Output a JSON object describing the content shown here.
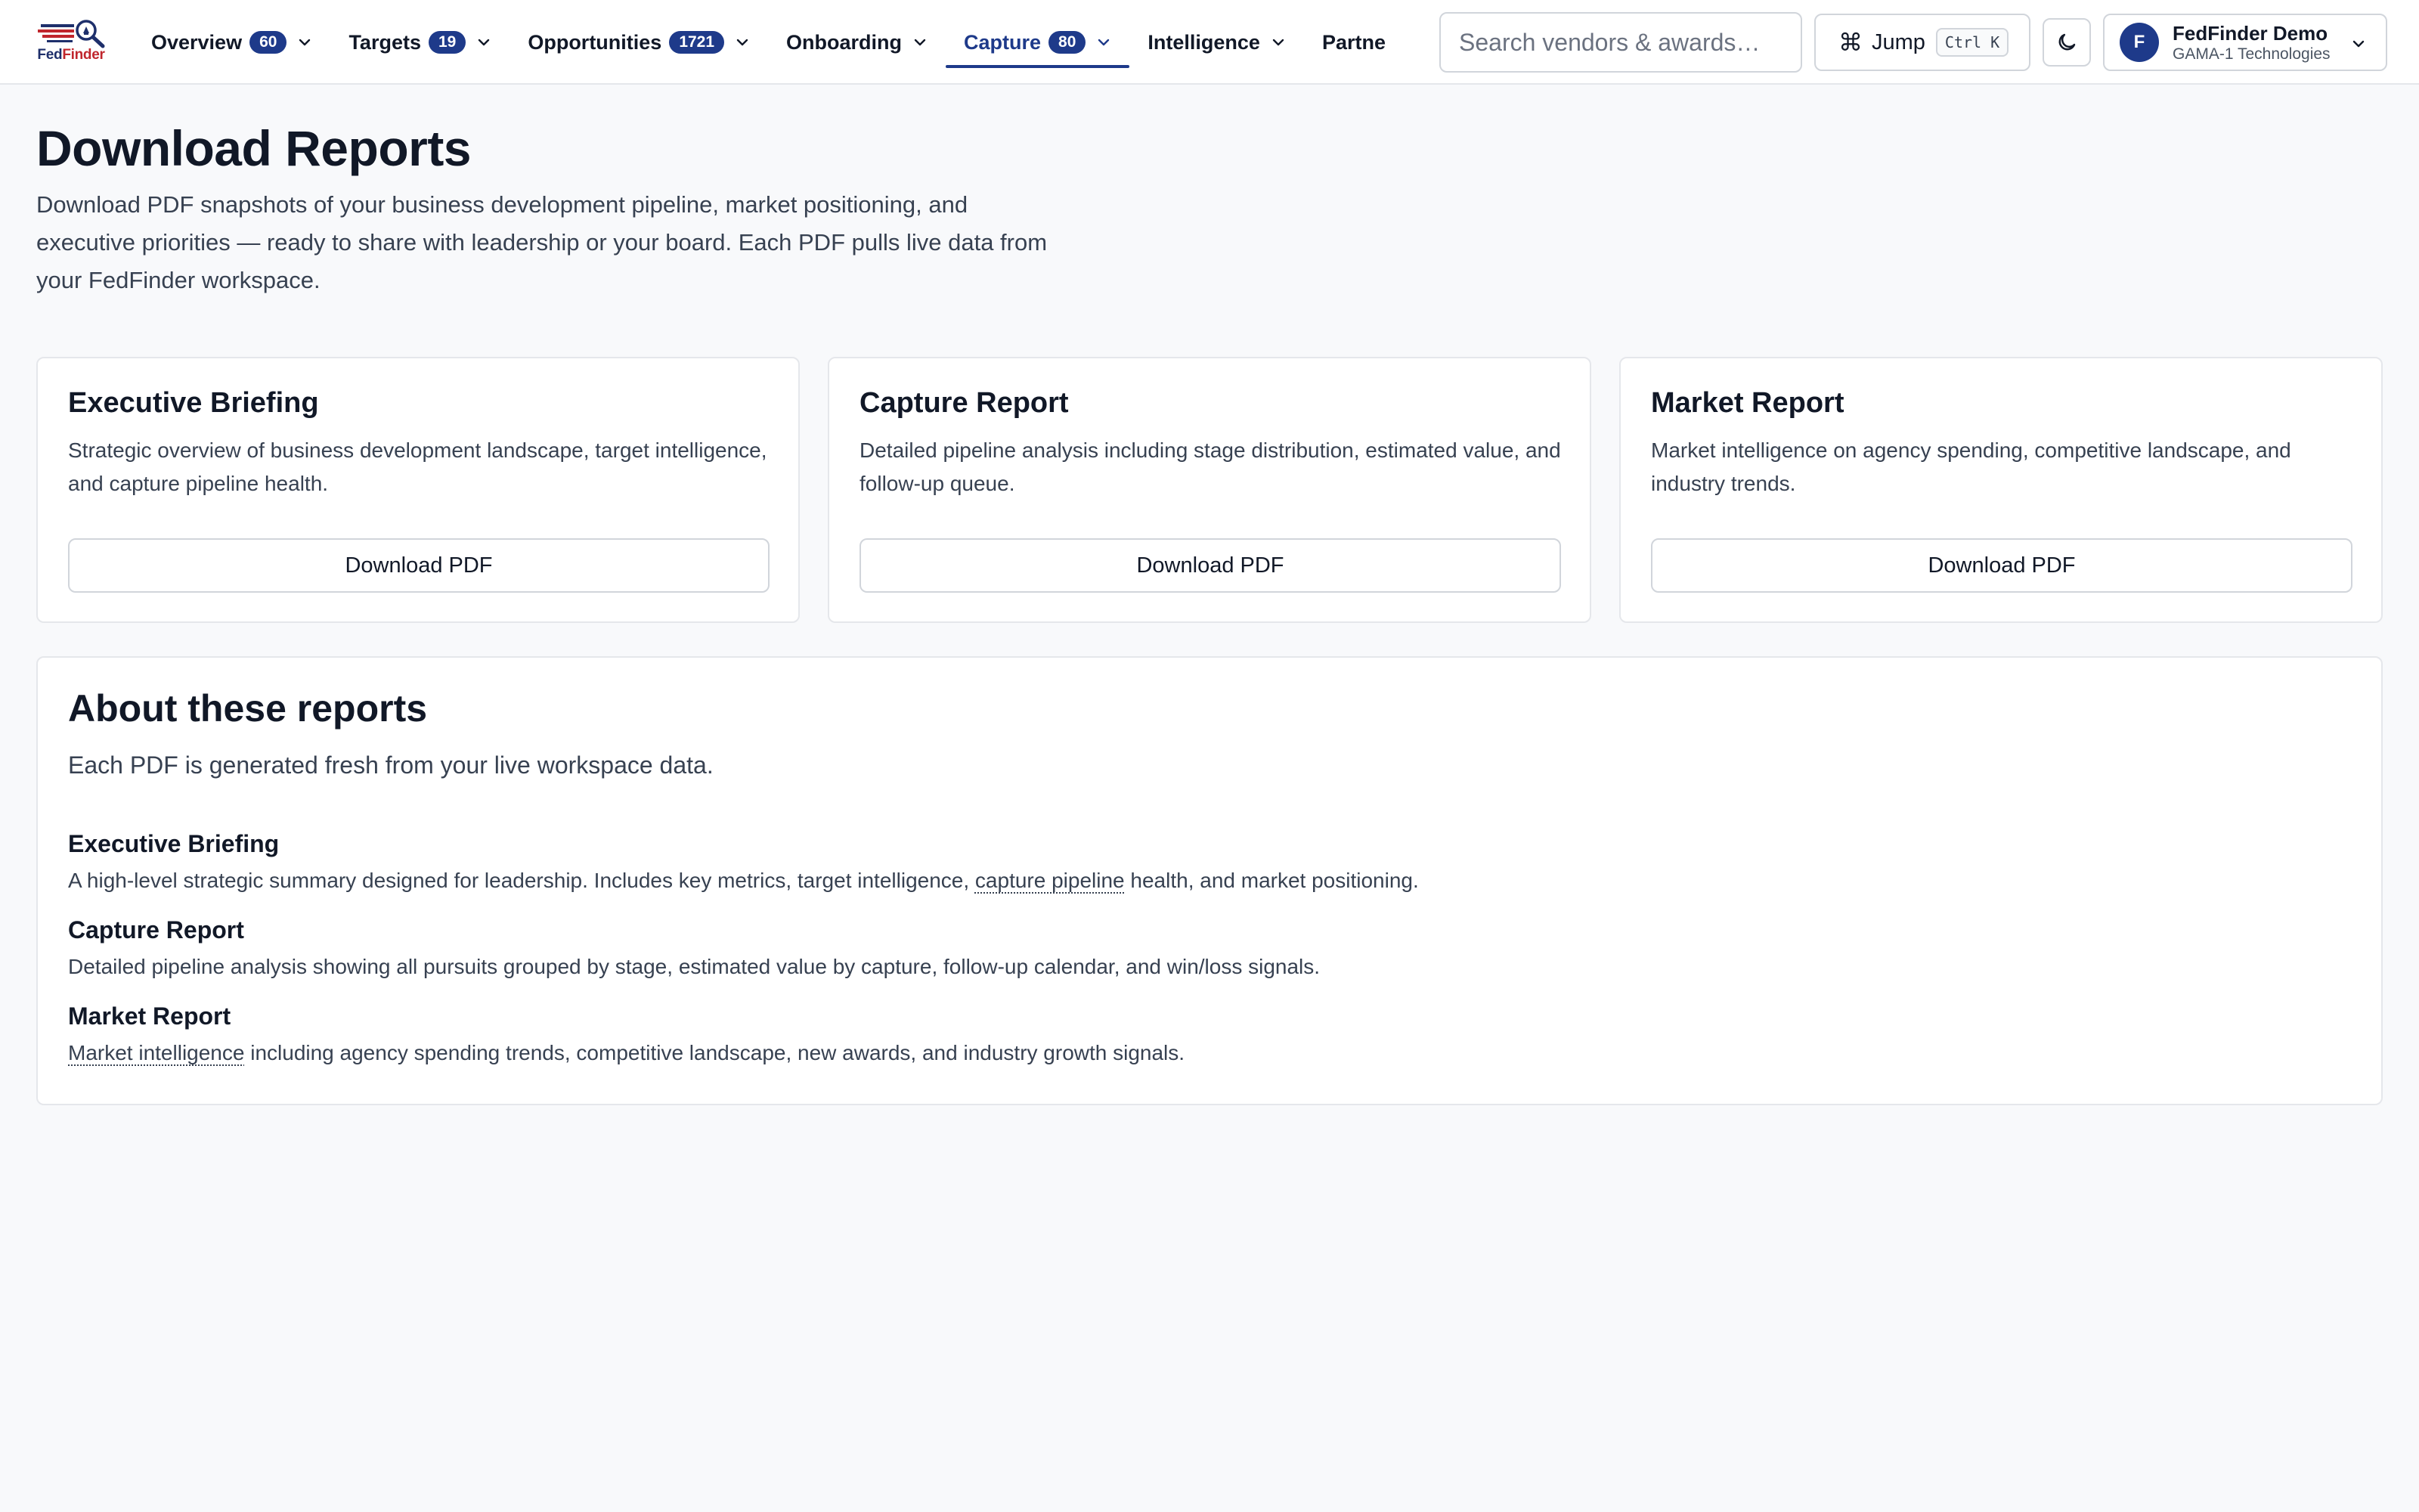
{
  "header": {
    "logo_fed": "Fed",
    "logo_finder": "Finder",
    "nav": [
      {
        "label": "Overview",
        "badge": "60"
      },
      {
        "label": "Targets",
        "badge": "19"
      },
      {
        "label": "Opportunities",
        "badge": "1721"
      },
      {
        "label": "Onboarding",
        "badge": ""
      },
      {
        "label": "Capture",
        "badge": "80",
        "active": true
      },
      {
        "label": "Intelligence",
        "badge": ""
      },
      {
        "label": "Partne",
        "badge": ""
      }
    ],
    "search_placeholder": "Search vendors & awards…",
    "jump_label": "Jump",
    "jump_shortcut": "Ctrl K",
    "jump_icon": "⌘",
    "theme_icon": "moon-icon",
    "user": {
      "initial": "F",
      "name": "FedFinder Demo",
      "org": "GAMA-1 Technologies"
    },
    "accent_color": "#1e3a8a"
  },
  "page": {
    "title": "Download Reports",
    "description": "Download PDF snapshots of your business development pipeline, market positioning, and executive priorities — ready to share with leadership or your board. Each PDF pulls live data from your FedFinder workspace."
  },
  "cards": [
    {
      "title": "Executive Briefing",
      "description": "Strategic overview of business development landscape, target intelligence, and capture pipeline health.",
      "button": "Download PDF"
    },
    {
      "title": "Capture Report",
      "description": "Detailed pipeline analysis including stage distribution, estimated value, and follow-up queue.",
      "button": "Download PDF"
    },
    {
      "title": "Market Report",
      "description": "Market intelligence on agency spending, competitive landscape, and industry trends.",
      "button": "Download PDF"
    }
  ],
  "about": {
    "title": "About these reports",
    "subtitle": "Each PDF is generated fresh from your live workspace data.",
    "items": [
      {
        "title": "Executive Briefing",
        "pre": "A high-level strategic summary designed for leadership. Includes key metrics, target intelligence, ",
        "term": "capture pipeline",
        "post": " health, and market positioning."
      },
      {
        "title": "Capture Report",
        "pre": "Detailed pipeline analysis showing all pursuits grouped by stage, estimated value by capture, follow-up calendar, and win/loss signals.",
        "term": "",
        "post": ""
      },
      {
        "title": "Market Report",
        "pre": "",
        "term": "Market intelligence",
        "post": " including agency spending trends, competitive landscape, new awards, and industry growth signals."
      }
    ]
  }
}
